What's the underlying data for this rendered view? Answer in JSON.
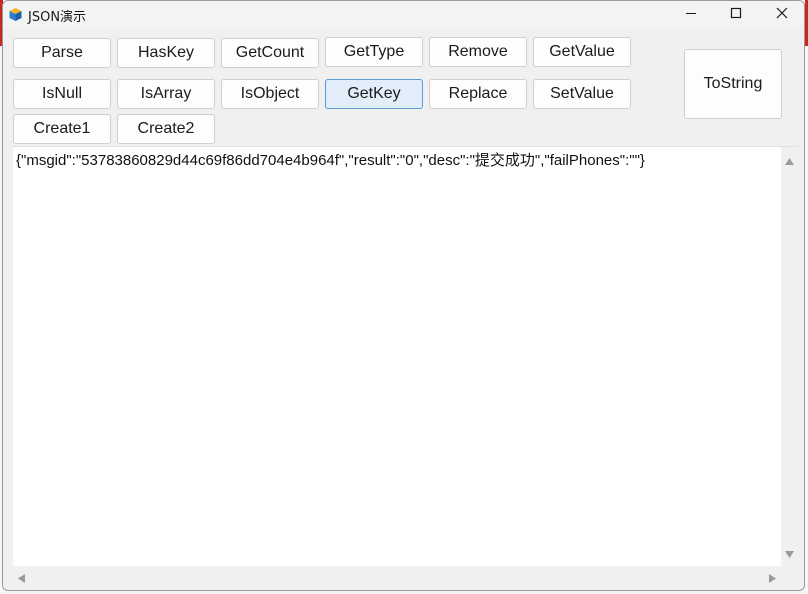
{
  "window": {
    "title": "JSON演示"
  },
  "titlebar": {
    "minimize_icon": "minimize-icon",
    "maximize_icon": "maximize-icon",
    "close_icon": "close-icon"
  },
  "buttons": {
    "row1": [
      "Parse",
      "HasKey",
      "GetCount",
      "GetType",
      "Remove",
      "GetValue"
    ],
    "row2": [
      "IsNull",
      "IsArray",
      "IsObject",
      "GetKey",
      "Replace",
      "SetValue"
    ],
    "row3": [
      "Create1",
      "Create2"
    ],
    "tostring": "ToString"
  },
  "focused_button": "GetKey",
  "editor": {
    "content": "{\"msgid\":\"53783860829d44c69f86dd704e4b964f\",\"result\":\"0\",\"desc\":\"提交成功\",\"failPhones\":\"\"}"
  },
  "colors": {
    "focus_border": "#5b9bd5",
    "focus_fill": "#e1eef9",
    "window_bg": "#f0f0f0"
  }
}
